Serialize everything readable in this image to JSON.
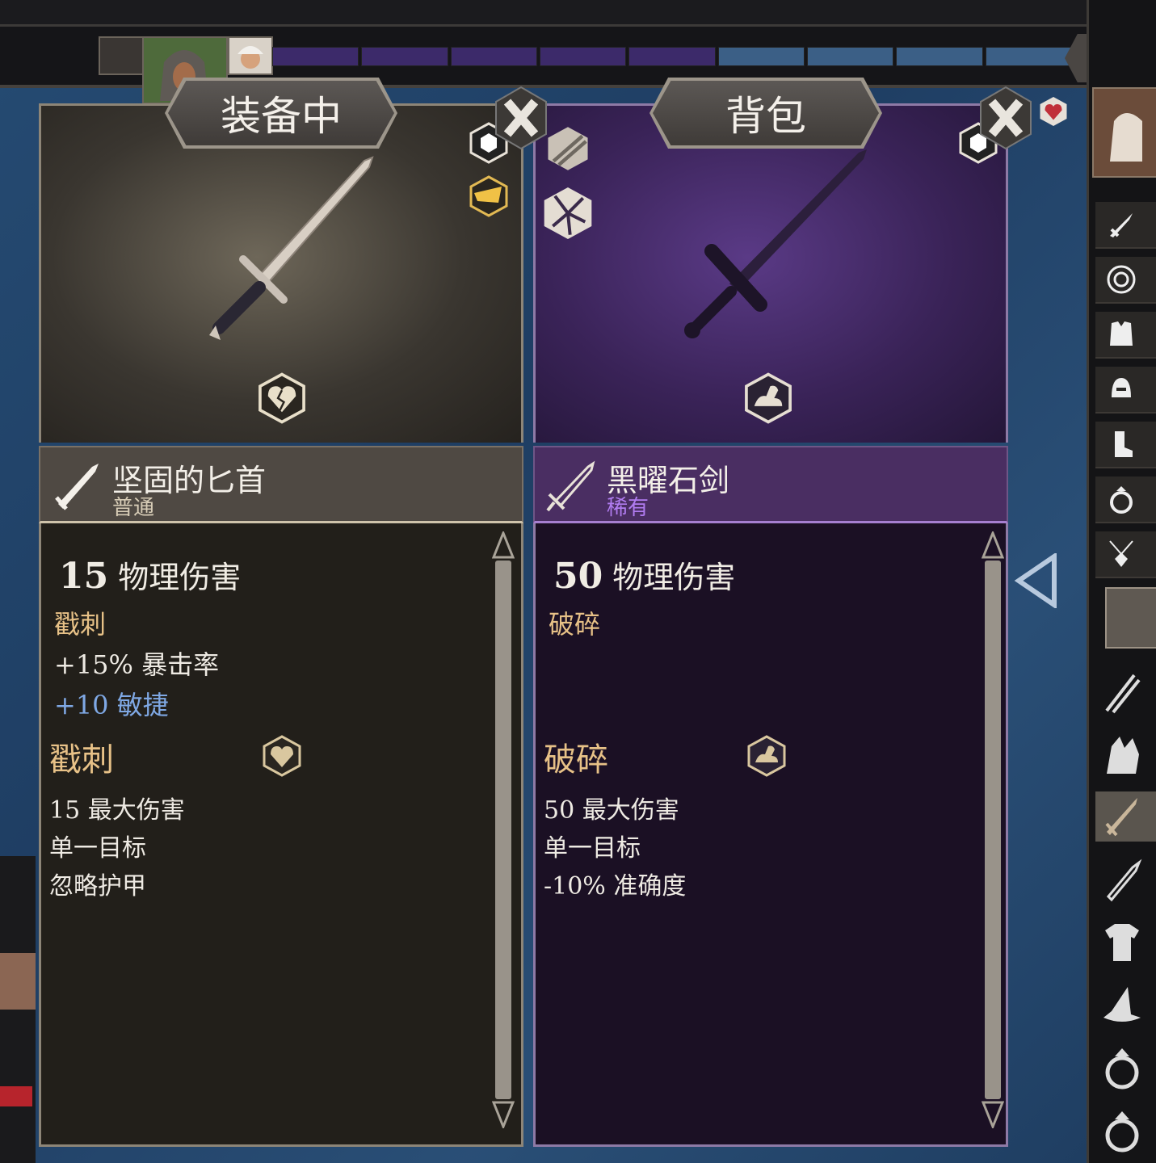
{
  "tabs": {
    "equipped_label": "装备中",
    "backpack_label": "背包"
  },
  "equipped": {
    "item_name": "坚固的匕首",
    "rarity": "普通",
    "main_stat_value": "15",
    "main_stat_label": "物理伤害",
    "damage_type": "戳刺",
    "bonuses": [
      "+15% 暴击率",
      "+10 敏捷"
    ],
    "ability": {
      "title": "戳刺",
      "lines": [
        "15 最大伤害",
        "单一目标",
        "忽略护甲"
      ]
    }
  },
  "backpack": {
    "item_name": "黑曜石剑",
    "rarity": "稀有",
    "main_stat_value": "50",
    "main_stat_label": "物理伤害",
    "damage_type": "破碎",
    "bonuses": [],
    "ability": {
      "title": "破碎",
      "lines": [
        "50 最大伤害",
        "单一目标",
        "-10% 准确度"
      ]
    }
  },
  "colors": {
    "rarity_common": "#d8cdb7",
    "rarity_rare": "#b07cf0",
    "gold_text": "#e7c187",
    "blue_bonus": "#7fa8e4"
  },
  "icons": {
    "close": "close-x-icon",
    "equipped_damage_type": "broken-heart-icon",
    "backpack_damage_type": "flexed-arm-icon"
  },
  "rail_slots": [
    "sword-icon",
    "shield-icon",
    "armor-icon",
    "helmet-icon",
    "boot-icon",
    "ring-icon",
    "amulet-icon"
  ],
  "rail_categories": [
    "spears-icon",
    "crystals-icon",
    "sword-icon",
    "dagger-icon",
    "shirt-icon",
    "wizard-hat-icon",
    "ring-icon",
    "ring-icon"
  ]
}
